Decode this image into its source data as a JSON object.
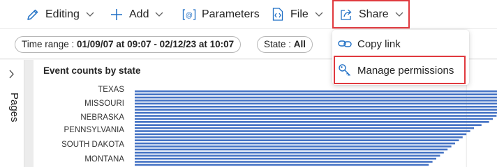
{
  "toolbar": {
    "editing_label": "Editing",
    "add_label": "Add",
    "parameters_label": "Parameters",
    "file_label": "File",
    "share_label": "Share"
  },
  "filters": {
    "time_range_key": "Time range : ",
    "time_range_value": "01/09/07 at 09:07 - 02/12/23 at 10:07",
    "state_key": "State : ",
    "state_value": "All"
  },
  "pages_rail": {
    "label": "Pages"
  },
  "share_menu": {
    "items": [
      {
        "label": "Copy link",
        "icon": "link-icon"
      },
      {
        "label": "Manage permissions",
        "icon": "key-icon"
      }
    ]
  },
  "colors": {
    "bar": "#4472c4",
    "highlight": "#e0393e",
    "accent": "#1f6fc5"
  },
  "chart_data": {
    "type": "bar",
    "orientation": "horizontal",
    "title": "Event counts by state",
    "labeled_categories": [
      "TEXAS",
      "MISSOURI",
      "NEBRASKA",
      "PENNSYLVANIA",
      "SOUTH DAKOTA",
      "MONTANA"
    ],
    "bar_values": [
      1,
      1,
      1,
      1,
      0.99,
      0.99,
      0.98,
      0.97,
      0.96,
      0.95,
      0.94,
      0.92,
      0.9,
      0.89,
      0.88,
      0.87,
      0.86,
      0.85,
      0.84,
      0.83,
      0.82,
      0.81,
      0.8,
      0.79,
      0.78,
      0.77
    ],
    "grid": true
  }
}
